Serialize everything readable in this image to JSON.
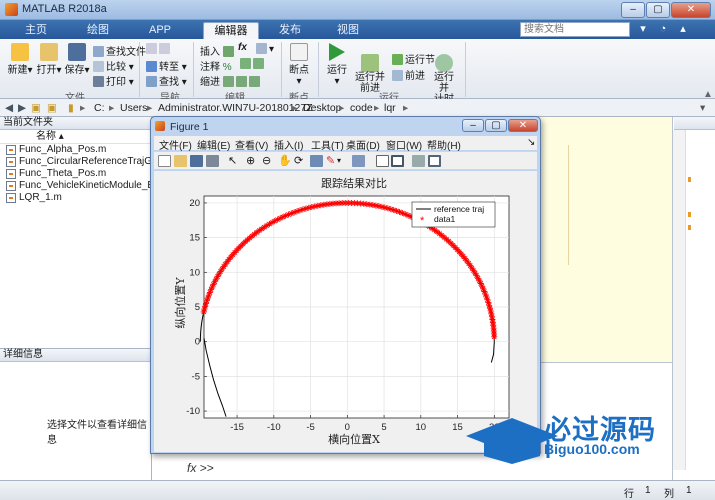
{
  "window": {
    "title": "MATLAB R2018a"
  },
  "tabs": [
    {
      "label": "主页"
    },
    {
      "label": "绘图"
    },
    {
      "label": "APP"
    },
    {
      "label": "编辑器"
    },
    {
      "label": "发布"
    },
    {
      "label": "视图"
    }
  ],
  "search": {
    "placeholder": "搜索文档"
  },
  "ribbon": {
    "new": "新建",
    "open": "打开",
    "save": "保存",
    "find_files": "查找文件",
    "compare": "比较",
    "print": "打印",
    "goto": "转至",
    "find": "查找",
    "insert": "插入",
    "fx": "fx",
    "comment": "注释",
    "comment_pct": "%",
    "indent": "缩进",
    "breakpoints": "断点",
    "run": "运行",
    "run_advance": "运行并\n前进",
    "run_section": "运行节",
    "advance": "前进",
    "run_time": "运行并\n计时",
    "groups": {
      "file": "文件",
      "navigate": "导航",
      "edit": "编辑",
      "breakpoints": "断点",
      "run": "运行"
    }
  },
  "address": {
    "crumbs": [
      "C:",
      "Users",
      "Administrator.WIN7U-20180127Z",
      "Desktop",
      "code",
      "lqr"
    ]
  },
  "current_folder": {
    "header": "当前文件夹",
    "column": "名称",
    "files": [
      "Func_Alpha_Pos.m",
      "Func_CircularReferenceTrajGe",
      "Func_Theta_Pos.m",
      "Func_VehicleKineticModule_Eu",
      "LQR_1.m"
    ]
  },
  "details": {
    "header": "详细信息",
    "message": "选择文件以查看详细信息"
  },
  "command": {
    "prompt": "fx >>"
  },
  "status": {
    "row_label": "行",
    "row": "1",
    "col_label": "列",
    "col": "1"
  },
  "figure": {
    "title": "Figure 1",
    "menu": [
      "文件(F)",
      "编辑(E)",
      "查看(V)",
      "插入(I)",
      "工具(T)",
      "桌面(D)",
      "窗口(W)",
      "帮助(H)"
    ]
  },
  "watermark": {
    "text": "必过源码",
    "url": "Biguo100.com"
  },
  "colors": {
    "reference": "#000000",
    "data1": "#ff0000",
    "accent": "#28579a"
  },
  "chart_data": {
    "type": "line",
    "title": "跟踪结果对比",
    "xlabel": "横向位置X",
    "ylabel": "纵向位置Y",
    "xlim": [
      -19.5,
      22
    ],
    "ylim": [
      -11,
      21
    ],
    "xticks": [
      -15,
      -10,
      -5,
      0,
      5,
      10,
      15,
      20
    ],
    "yticks": [
      -10,
      -5,
      0,
      5,
      10,
      15,
      20
    ],
    "grid": true,
    "legend_position": "top-right",
    "series": [
      {
        "name": "reference traj",
        "style": "line",
        "color": "#000000",
        "x": [
          -16.5,
          -17.0,
          -17.6,
          -18.2,
          -18.7,
          -19.2,
          -19.5
        ],
        "y": [
          -10.8,
          -9.2,
          -7.5,
          -5.5,
          -3.5,
          -1.3,
          0.5
        ],
        "circle": {
          "cx": 0,
          "cy": 0,
          "r": 20,
          "from_deg": 0,
          "to_deg": 180
        }
      },
      {
        "name": "data1",
        "style": "marker-star",
        "color": "#ff0000",
        "circle": {
          "cx": 0,
          "cy": 0,
          "r": 20,
          "from_deg": 2,
          "to_deg": 168
        }
      }
    ]
  }
}
